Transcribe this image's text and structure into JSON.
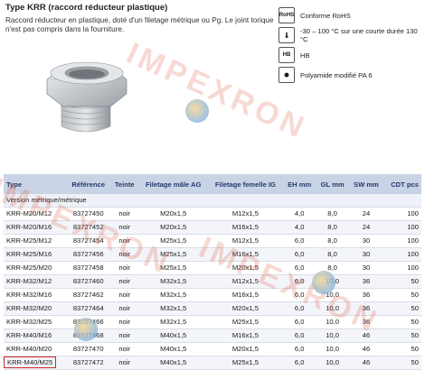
{
  "title": "Type KRR (raccord réducteur plastique)",
  "description": "Raccord réducteur en plastique, doté d'un filetage métrique ou Pg. Le joint torique n'est pas compris dans la fourniture.",
  "specs": [
    {
      "icon": "rohs-icon",
      "icon_text": "RoHS",
      "text": "Conforme RoHS"
    },
    {
      "icon": "thermometer-icon",
      "icon_text": "🌡",
      "text": "-30 – 100 °C sur une courte durée 130 °C"
    },
    {
      "icon": "flame-icon",
      "icon_text": "HB",
      "text": "HB"
    },
    {
      "icon": "material-icon",
      "icon_text": "⬢",
      "text": "Polyamide modifié PA 6"
    }
  ],
  "watermark": "IMPEXRON",
  "table": {
    "headers": [
      "Type",
      "Référence",
      "Teinte",
      "Filetage mâle AG",
      "Filetage femelle IG",
      "EH mm",
      "GL mm",
      "SW mm",
      "CDT pcs"
    ],
    "group": "Version métrique/métrique",
    "rows": [
      [
        "KRR-M20/M12",
        "83727450",
        "noir",
        "M20x1,5",
        "M12x1,5",
        "4,0",
        "8,0",
        "24",
        "100"
      ],
      [
        "KRR-M20/M16",
        "83727452",
        "noir",
        "M20x1,5",
        "M16x1,5",
        "4,0",
        "8,0",
        "24",
        "100"
      ],
      [
        "KRR-M25/M12",
        "83727454",
        "noir",
        "M25x1,5",
        "M12x1,5",
        "6,0",
        "8,0",
        "30",
        "100"
      ],
      [
        "KRR-M25/M16",
        "83727456",
        "noir",
        "M25x1,5",
        "M16x1,5",
        "6,0",
        "8,0",
        "30",
        "100"
      ],
      [
        "KRR-M25/M20",
        "83727458",
        "noir",
        "M25x1,5",
        "M20x1,5",
        "6,0",
        "8,0",
        "30",
        "100"
      ],
      [
        "KRR-M32/M12",
        "83727460",
        "noir",
        "M32x1,5",
        "M12x1,5",
        "6,0",
        "10,0",
        "36",
        "50"
      ],
      [
        "KRR-M32/M16",
        "83727462",
        "noir",
        "M32x1,5",
        "M16x1,5",
        "6,0",
        "10,0",
        "36",
        "50"
      ],
      [
        "KRR-M32/M20",
        "83727464",
        "noir",
        "M32x1,5",
        "M20x1,5",
        "6,0",
        "10,0",
        "36",
        "50"
      ],
      [
        "KRR-M32/M25",
        "83727466",
        "noir",
        "M32x1,5",
        "M25x1,5",
        "6,0",
        "10,0",
        "36",
        "50"
      ],
      [
        "KRR-M40/M16",
        "83727468",
        "noir",
        "M40x1,5",
        "M16x1,5",
        "6,0",
        "10,0",
        "46",
        "50"
      ],
      [
        "KRR-M40/M20",
        "83727470",
        "noir",
        "M40x1,5",
        "M20x1,5",
        "6,0",
        "10,0",
        "46",
        "50"
      ],
      [
        "KRR-M40/M25",
        "83727472",
        "noir",
        "M40x1,5",
        "M25x1,5",
        "6,0",
        "10,0",
        "46",
        "50"
      ]
    ],
    "highlighted_row": 11
  },
  "colors": {
    "header_bg": "#c9d3e6",
    "header_text": "#233a6a",
    "highlight": "#d0292f",
    "watermark": "#dc503c"
  }
}
